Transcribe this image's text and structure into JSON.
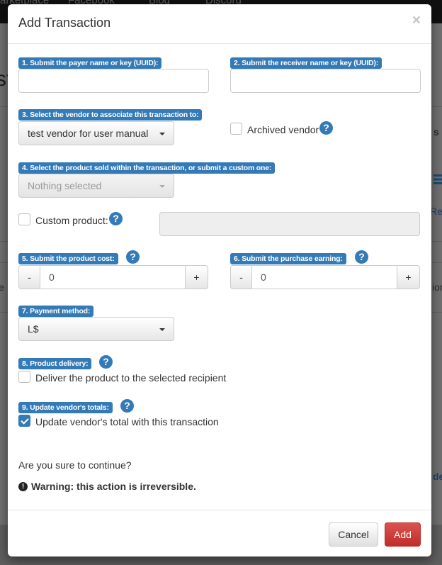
{
  "background": {
    "nav": [
      "arketplace",
      "Facebook",
      "Blog",
      "Discord"
    ],
    "title_fragment": "st",
    "side_fragments": [
      "s",
      "Rec",
      "ion",
      "de"
    ],
    "left_fragment": "e"
  },
  "modal": {
    "title": "Add Transaction",
    "close_glyph": "×",
    "fields": {
      "payer": {
        "label": "1. Submit the payer name or key (UUID):",
        "value": ""
      },
      "receiver": {
        "label": "2. Submit the receiver name or key (UUID):",
        "value": ""
      },
      "vendor": {
        "label": "3. Select the vendor to associate this transaction to:",
        "selected": "test vendor for user manual"
      },
      "archived_vendor": {
        "label": "Archived vendor",
        "checked": false
      },
      "product": {
        "label": "4. Select the product sold within the transaction, or submit a custom one:",
        "selected": "Nothing selected"
      },
      "custom_product": {
        "label": "Custom product:",
        "checked": false,
        "value": ""
      },
      "product_cost": {
        "label": "5. Submit the product cost:",
        "value": "0",
        "minus": "-",
        "plus": "+"
      },
      "purchase_earning": {
        "label": "6. Submit the purchase earning:",
        "value": "0",
        "minus": "-",
        "plus": "+"
      },
      "payment_method": {
        "label": "7. Payment method:",
        "selected": "L$"
      },
      "product_delivery": {
        "label": "8. Product delivery:",
        "checkbox_label": "Deliver the product to the selected recipient",
        "checked": false
      },
      "update_totals": {
        "label": "9. Update vendor's totals:",
        "checkbox_label": "Update vendor's total with this transaction",
        "checked": true
      }
    },
    "help_glyph": "?",
    "confirm_text": "Are you sure to continue?",
    "warning_text": "Warning: this action is irreversible.",
    "warning_glyph": "!",
    "buttons": {
      "cancel": "Cancel",
      "add": "Add"
    }
  },
  "colors": {
    "primary": "#337ab7",
    "danger": "#d9534f"
  }
}
